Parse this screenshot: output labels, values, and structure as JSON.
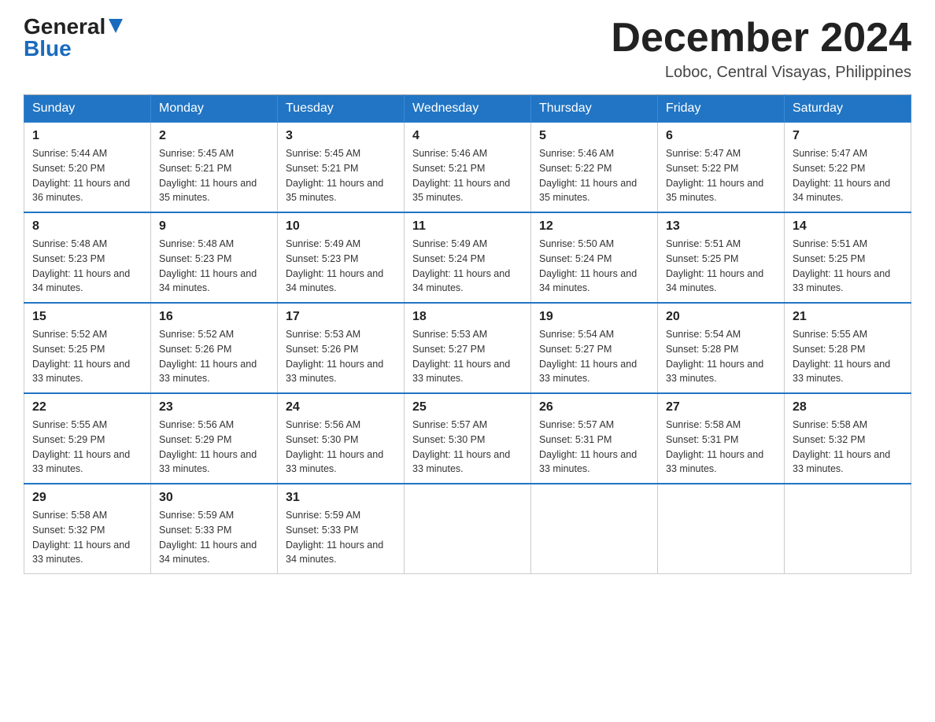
{
  "header": {
    "logo_general": "General",
    "logo_blue": "Blue",
    "month_title": "December 2024",
    "location": "Loboc, Central Visayas, Philippines"
  },
  "days_of_week": [
    "Sunday",
    "Monday",
    "Tuesday",
    "Wednesday",
    "Thursday",
    "Friday",
    "Saturday"
  ],
  "weeks": [
    [
      {
        "day": "1",
        "sunrise": "5:44 AM",
        "sunset": "5:20 PM",
        "daylight": "11 hours and 36 minutes."
      },
      {
        "day": "2",
        "sunrise": "5:45 AM",
        "sunset": "5:21 PM",
        "daylight": "11 hours and 35 minutes."
      },
      {
        "day": "3",
        "sunrise": "5:45 AM",
        "sunset": "5:21 PM",
        "daylight": "11 hours and 35 minutes."
      },
      {
        "day": "4",
        "sunrise": "5:46 AM",
        "sunset": "5:21 PM",
        "daylight": "11 hours and 35 minutes."
      },
      {
        "day": "5",
        "sunrise": "5:46 AM",
        "sunset": "5:22 PM",
        "daylight": "11 hours and 35 minutes."
      },
      {
        "day": "6",
        "sunrise": "5:47 AM",
        "sunset": "5:22 PM",
        "daylight": "11 hours and 35 minutes."
      },
      {
        "day": "7",
        "sunrise": "5:47 AM",
        "sunset": "5:22 PM",
        "daylight": "11 hours and 34 minutes."
      }
    ],
    [
      {
        "day": "8",
        "sunrise": "5:48 AM",
        "sunset": "5:23 PM",
        "daylight": "11 hours and 34 minutes."
      },
      {
        "day": "9",
        "sunrise": "5:48 AM",
        "sunset": "5:23 PM",
        "daylight": "11 hours and 34 minutes."
      },
      {
        "day": "10",
        "sunrise": "5:49 AM",
        "sunset": "5:23 PM",
        "daylight": "11 hours and 34 minutes."
      },
      {
        "day": "11",
        "sunrise": "5:49 AM",
        "sunset": "5:24 PM",
        "daylight": "11 hours and 34 minutes."
      },
      {
        "day": "12",
        "sunrise": "5:50 AM",
        "sunset": "5:24 PM",
        "daylight": "11 hours and 34 minutes."
      },
      {
        "day": "13",
        "sunrise": "5:51 AM",
        "sunset": "5:25 PM",
        "daylight": "11 hours and 34 minutes."
      },
      {
        "day": "14",
        "sunrise": "5:51 AM",
        "sunset": "5:25 PM",
        "daylight": "11 hours and 33 minutes."
      }
    ],
    [
      {
        "day": "15",
        "sunrise": "5:52 AM",
        "sunset": "5:25 PM",
        "daylight": "11 hours and 33 minutes."
      },
      {
        "day": "16",
        "sunrise": "5:52 AM",
        "sunset": "5:26 PM",
        "daylight": "11 hours and 33 minutes."
      },
      {
        "day": "17",
        "sunrise": "5:53 AM",
        "sunset": "5:26 PM",
        "daylight": "11 hours and 33 minutes."
      },
      {
        "day": "18",
        "sunrise": "5:53 AM",
        "sunset": "5:27 PM",
        "daylight": "11 hours and 33 minutes."
      },
      {
        "day": "19",
        "sunrise": "5:54 AM",
        "sunset": "5:27 PM",
        "daylight": "11 hours and 33 minutes."
      },
      {
        "day": "20",
        "sunrise": "5:54 AM",
        "sunset": "5:28 PM",
        "daylight": "11 hours and 33 minutes."
      },
      {
        "day": "21",
        "sunrise": "5:55 AM",
        "sunset": "5:28 PM",
        "daylight": "11 hours and 33 minutes."
      }
    ],
    [
      {
        "day": "22",
        "sunrise": "5:55 AM",
        "sunset": "5:29 PM",
        "daylight": "11 hours and 33 minutes."
      },
      {
        "day": "23",
        "sunrise": "5:56 AM",
        "sunset": "5:29 PM",
        "daylight": "11 hours and 33 minutes."
      },
      {
        "day": "24",
        "sunrise": "5:56 AM",
        "sunset": "5:30 PM",
        "daylight": "11 hours and 33 minutes."
      },
      {
        "day": "25",
        "sunrise": "5:57 AM",
        "sunset": "5:30 PM",
        "daylight": "11 hours and 33 minutes."
      },
      {
        "day": "26",
        "sunrise": "5:57 AM",
        "sunset": "5:31 PM",
        "daylight": "11 hours and 33 minutes."
      },
      {
        "day": "27",
        "sunrise": "5:58 AM",
        "sunset": "5:31 PM",
        "daylight": "11 hours and 33 minutes."
      },
      {
        "day": "28",
        "sunrise": "5:58 AM",
        "sunset": "5:32 PM",
        "daylight": "11 hours and 33 minutes."
      }
    ],
    [
      {
        "day": "29",
        "sunrise": "5:58 AM",
        "sunset": "5:32 PM",
        "daylight": "11 hours and 33 minutes."
      },
      {
        "day": "30",
        "sunrise": "5:59 AM",
        "sunset": "5:33 PM",
        "daylight": "11 hours and 34 minutes."
      },
      {
        "day": "31",
        "sunrise": "5:59 AM",
        "sunset": "5:33 PM",
        "daylight": "11 hours and 34 minutes."
      },
      null,
      null,
      null,
      null
    ]
  ]
}
